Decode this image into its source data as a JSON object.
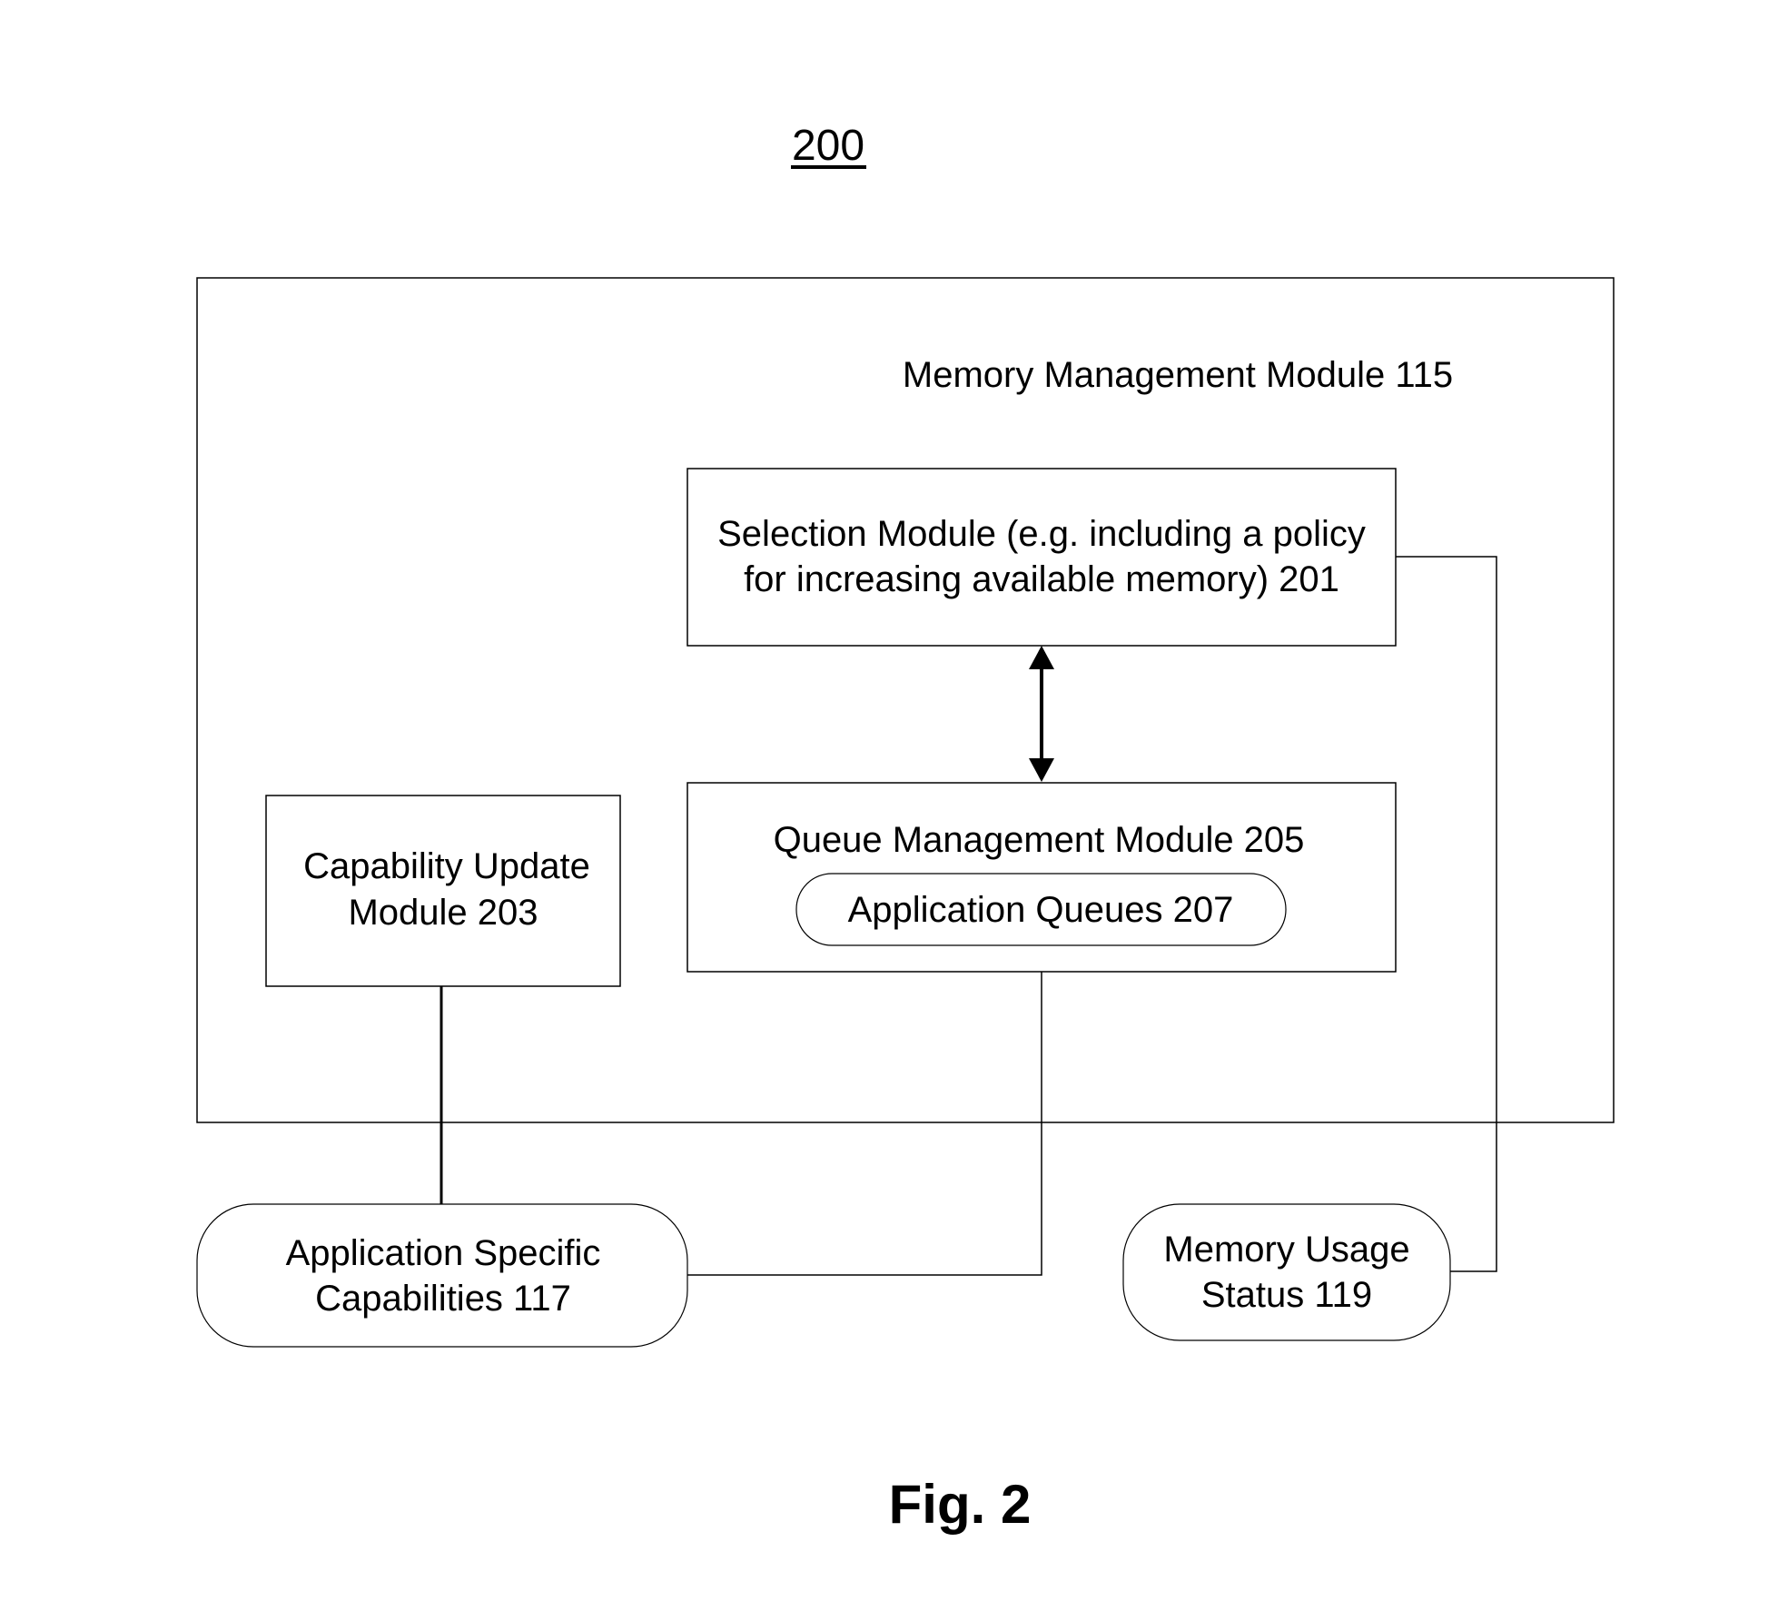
{
  "figure": {
    "reference_number": "200",
    "caption": "Fig. 2"
  },
  "container": {
    "label": "Memory Management Module 115"
  },
  "nodes": {
    "selection_module": {
      "lines": [
        "Selection Module (e.g. including a policy",
        "for increasing available memory) 201"
      ]
    },
    "queue_management_module": {
      "label": "Queue Management Module 205"
    },
    "application_queues": {
      "label": "Application Queues 207"
    },
    "capability_update_module": {
      "lines": [
        "Capability Update",
        "Module 203"
      ]
    },
    "application_specific_capabilities": {
      "lines": [
        "Application Specific",
        "Capabilities 117"
      ]
    },
    "memory_usage_status": {
      "lines": [
        "Memory Usage",
        "Status 119"
      ]
    }
  },
  "edges": [
    {
      "from": "selection_module",
      "to": "queue_management_module",
      "type": "bidirectional-arrow"
    },
    {
      "from": "capability_update_module",
      "to": "application_specific_capabilities",
      "type": "line"
    },
    {
      "from": "queue_management_module",
      "to": "application_specific_capabilities",
      "type": "line"
    },
    {
      "from": "selection_module",
      "to": "memory_usage_status",
      "type": "line"
    }
  ]
}
